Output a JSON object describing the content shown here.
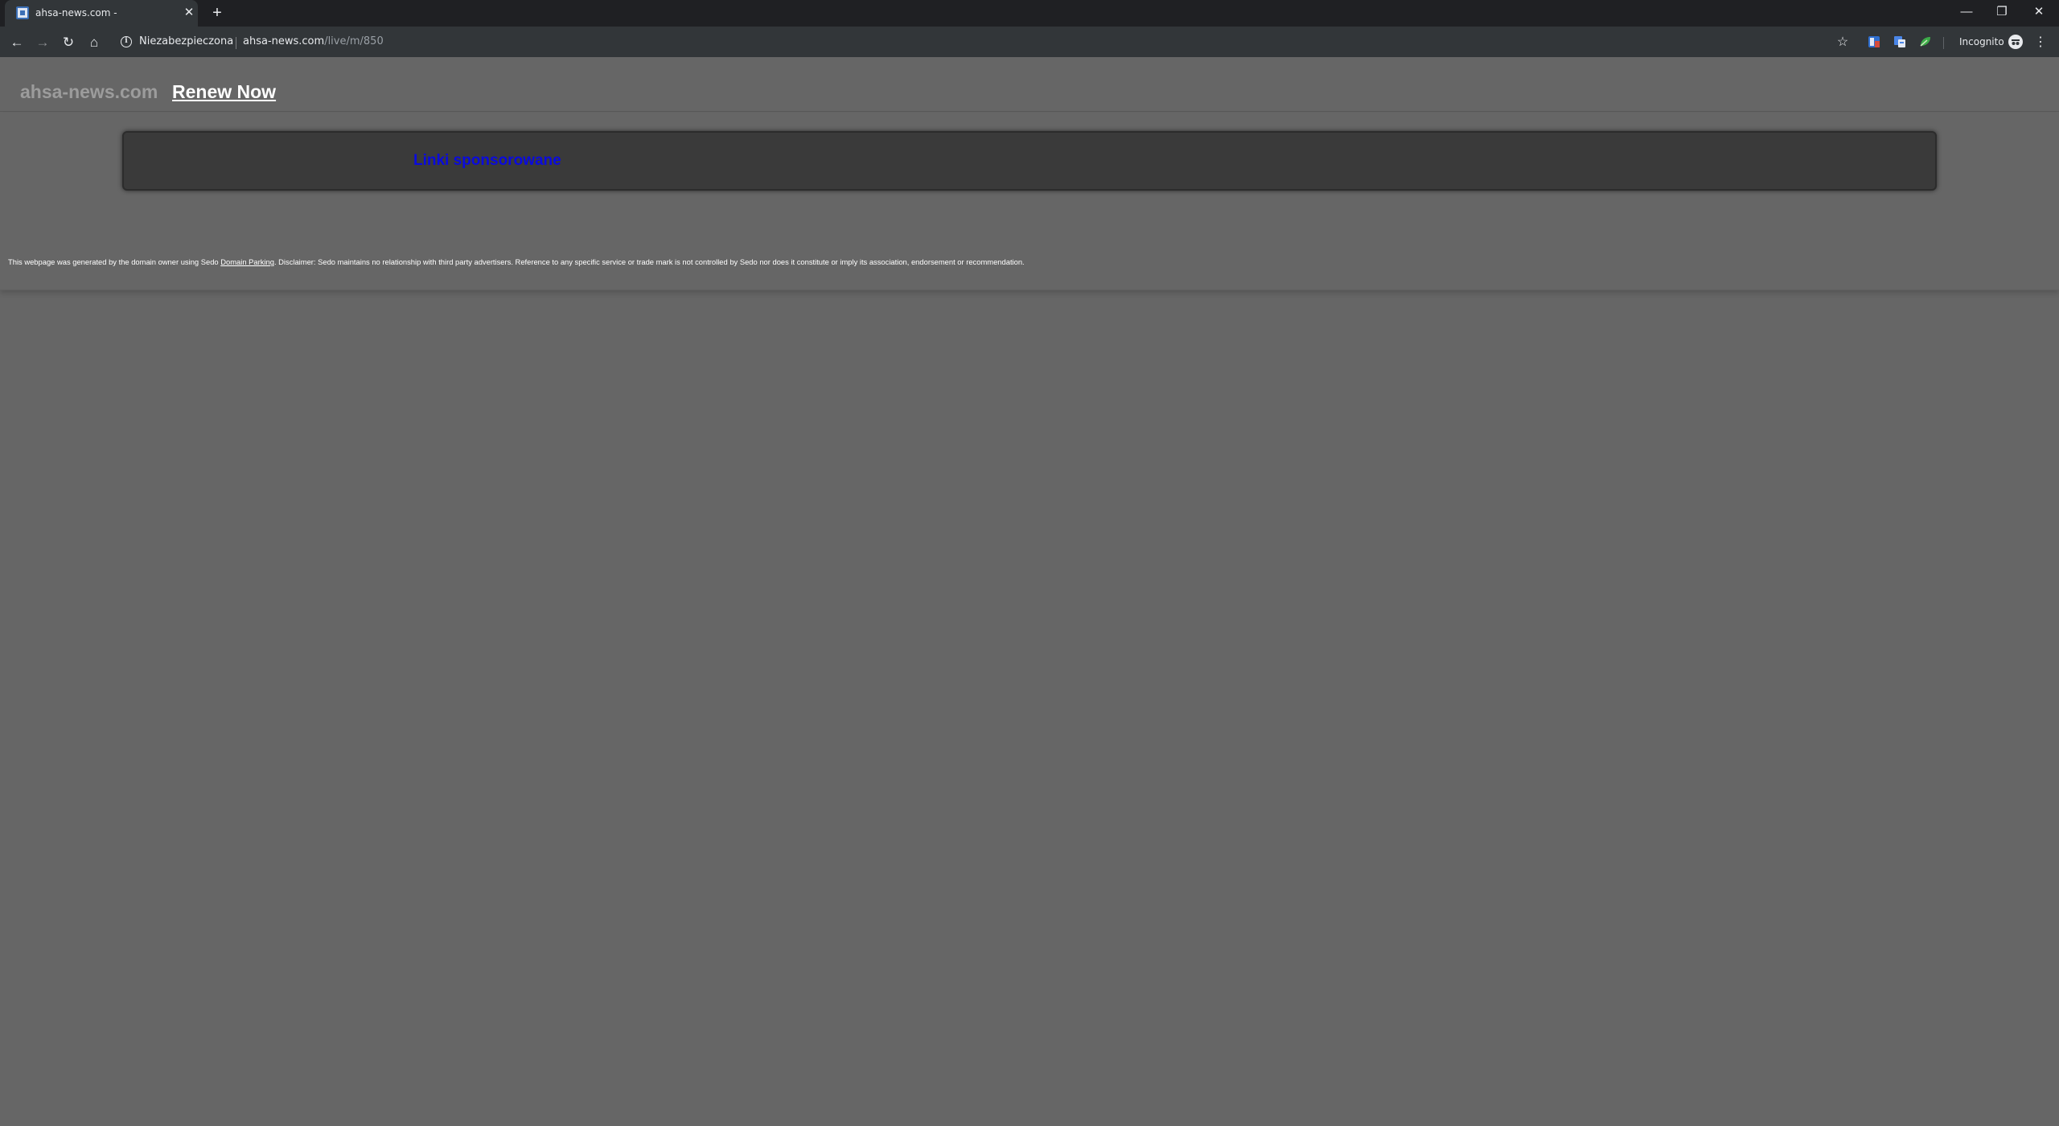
{
  "browser": {
    "tab": {
      "title": "ahsa-news.com -"
    },
    "security_label": "Niezabezpieczona",
    "url": {
      "host": "ahsa-news.com",
      "path": "/live/m/850"
    },
    "profile_label": "Incognito",
    "icons": {
      "close": "✕",
      "new_tab": "+",
      "minimize": "—",
      "maximize": "❐",
      "window_close": "✕",
      "back": "←",
      "forward": "→",
      "reload": "↻",
      "home": "⌂",
      "info": "i",
      "star": "☆",
      "menu": "⋮"
    }
  },
  "page": {
    "domain": "ahsa-news.com",
    "renew_label": "Renew Now",
    "sponsored_label": "Linki sponsorowane",
    "footer": {
      "before": "This webpage was generated by the domain owner using Sedo ",
      "link": "Domain Parking",
      "after": ". Disclaimer: Sedo maintains no relationship with third party advertisers. Reference to any specific service or trade mark is not controlled by Sedo nor does it constitute or imply its association, endorsement or recommendation."
    }
  },
  "colors": {
    "page_bg": "#666666",
    "ad_box_bg": "#3a3a3a",
    "sponsored_link": "#0a0adf",
    "domain_text": "#9c9c9c",
    "chrome_dark": "#1f2023",
    "chrome_toolbar": "#323639"
  }
}
